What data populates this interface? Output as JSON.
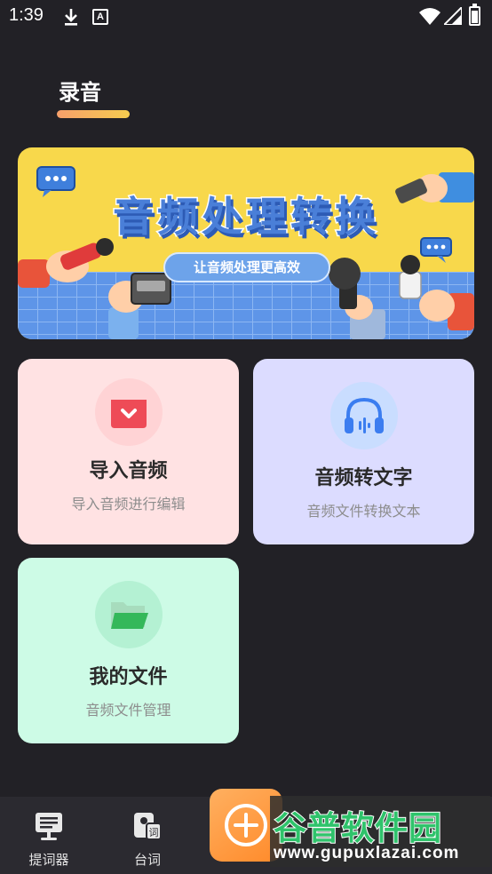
{
  "status_bar": {
    "time": "1:39",
    "notif_a": "A"
  },
  "header": {
    "title": "录音"
  },
  "banner": {
    "title": "音频处理转换",
    "subtitle": "让音频处理更高效"
  },
  "cards": {
    "import": {
      "title": "导入音频",
      "subtitle": "导入音频进行编辑",
      "bg": "#ffe2e3",
      "accent": "#ee4b57",
      "icon": "import-box-icon"
    },
    "transcribe": {
      "title": "音频转文字",
      "subtitle": "音频文件转换文本",
      "bg": "#dcdcff",
      "accent": "#3b7df0",
      "icon": "headphones-icon"
    },
    "files": {
      "title": "我的文件",
      "subtitle": "音频文件管理",
      "bg": "#cdfbe6",
      "accent": "#34b85a",
      "icon": "folder-icon"
    }
  },
  "tab_bar": {
    "tabs": [
      {
        "label": "提词器",
        "icon": "teleprompter-icon"
      },
      {
        "label": "台词",
        "icon": "script-icon"
      }
    ],
    "fab_icon": "plus-circle-icon"
  },
  "watermark": {
    "brand": "谷普软件园",
    "url": "www.gupuxlazai.com"
  }
}
